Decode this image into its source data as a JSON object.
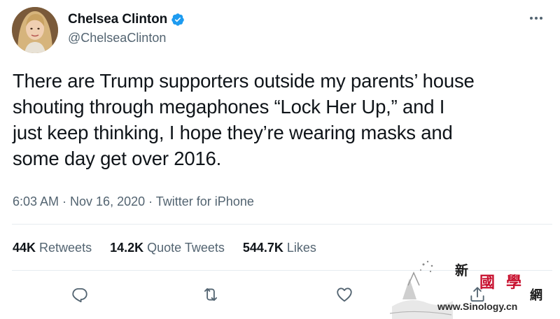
{
  "tweet": {
    "author": {
      "display_name": "Chelsea Clinton",
      "handle": "@ChelseaClinton",
      "verified": true
    },
    "text_lines": [
      "There are Trump supporters outside my parents’ house",
      "shouting through megaphones “Lock Her Up,” and I",
      "just keep thinking, I hope they’re wearing masks and",
      "some day get over 2016."
    ],
    "meta": "6:03 AM · Nov 16, 2020 · Twitter for iPhone",
    "stats": {
      "retweets": {
        "count": "44K",
        "label": "Retweets"
      },
      "quote_tweets": {
        "count": "14.2K",
        "label": "Quote Tweets"
      },
      "likes": {
        "count": "544.7K",
        "label": "Likes"
      }
    },
    "actions": [
      "reply-icon",
      "retweet-icon",
      "like-icon",
      "share-icon"
    ]
  },
  "watermark": {
    "chars": [
      "新",
      "國",
      "學",
      "網"
    ],
    "url": "www.Sinology.cn"
  },
  "colors": {
    "verified_blue": "#1d9bf0",
    "text_primary": "#0f1419",
    "text_secondary": "#536471",
    "divider": "#e6ecf0",
    "watermark_red": "#c8102e"
  }
}
